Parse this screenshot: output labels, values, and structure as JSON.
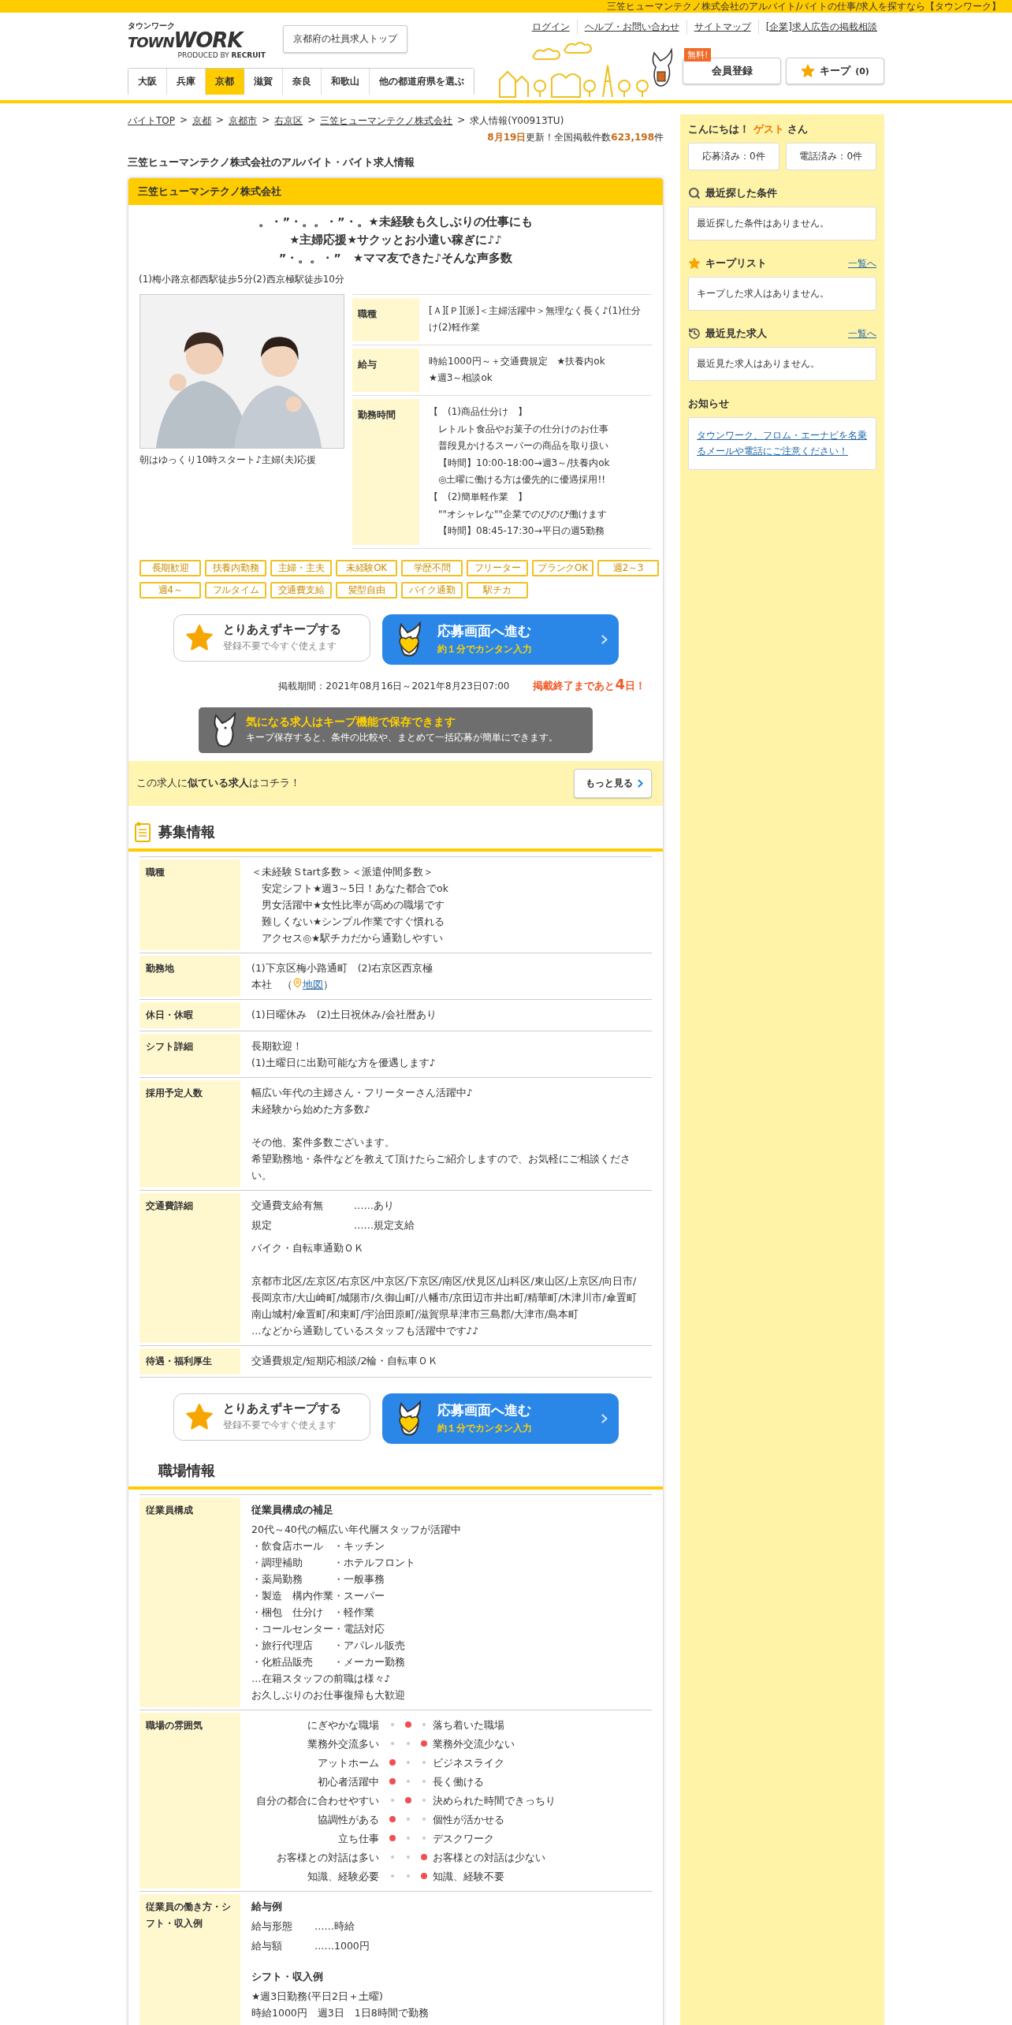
{
  "top_bar": {
    "text": "三笠ヒューマンテクノ株式会社のアルバイト/バイトの仕事/求人を探すなら【タウンワーク】"
  },
  "header": {
    "logo_kana": "タウンワーク",
    "logo_town": "TOWN",
    "logo_work": "WORK",
    "logo_sub": "PRODUCED BY",
    "logo_brand": "RECRUIT",
    "top_button": "京都府の社員求人トップ",
    "links": [
      "ログイン",
      "ヘルプ・お問い合わせ",
      "サイトマップ",
      "[企業]求人広告の掲載相談"
    ],
    "prefecture_tabs": [
      {
        "label": "大阪",
        "selected": false
      },
      {
        "label": "兵庫",
        "selected": false
      },
      {
        "label": "京都",
        "selected": true
      },
      {
        "label": "滋賀",
        "selected": false
      },
      {
        "label": "奈良",
        "selected": false
      },
      {
        "label": "和歌山",
        "selected": false
      },
      {
        "label": "他の都道府県を選ぶ",
        "selected": false
      }
    ],
    "free_badge": "無料!",
    "register_button": "会員登録",
    "keep_button": {
      "label": "キープ",
      "count": "(0)"
    }
  },
  "breadcrumb_separator": ">",
  "breadcrumb": [
    "バイトTOP",
    "京都",
    "京都市",
    "右京区",
    "三笠ヒューマンテクノ株式会社",
    "求人情報(Y00913TU)"
  ],
  "update": "**8月19日**更新！全国掲載件数**623,198**件",
  "page_title": "三笠ヒューマンテクノ株式会社のアルバイト・バイト求人情報",
  "job": {
    "company": "三笠ヒューマンテクノ株式会社",
    "catch": [
      "。・”・。。・”・。★未経験も久しぶりの仕事にも",
      "★主婦応援★サクッとお小遣い稼ぎに♪♪",
      "”・。。・”　★ママ友できた♪そんな声多数"
    ],
    "access": "(1)梅小路京都西駅徒歩5分(2)西京極駅徒歩10分",
    "photo_caption": "朝はゆっくり10時スタート♪主婦(夫)応援",
    "summary": [
      {
        "label": "職種",
        "lines": [
          "[Ａ][Ｐ][派]＜主婦活躍中＞無理なく長く♪(1)仕分け(2)軽作業"
        ]
      },
      {
        "label": "給与",
        "lines": [
          "時給1000円～＋交通費規定　★扶養内ok",
          "★週3～相談ok"
        ]
      },
      {
        "label": "勤務時間",
        "lines": [
          "【　(1)商品仕分け　】",
          "　レトルト食品やお菓子の仕分けのお仕事",
          "　普段見かけるスーパーの商品を取り扱い",
          "　【時間】10:00-18:00→週3～/扶養内ok",
          "　◎土曜に働ける方は優先的に優遇採用!!",
          "【　(2)簡単軽作業　】",
          "　\"\"オシャレな\"\"企業でのびのび働けます",
          "　【時間】08:45-17:30→平日の週5勤務"
        ]
      }
    ],
    "tags": [
      "長期歓迎",
      "扶養内勤務",
      "主婦・主夫",
      "未経験OK",
      "学歴不問",
      "フリーター",
      "ブランクOK",
      "週2～3",
      "週4～",
      "フルタイム",
      "交通費支給",
      "髪型自由",
      "バイク通勤",
      "駅チカ"
    ],
    "keep_button": {
      "title": "とりあえずキープする",
      "sub": "登録不要で今すぐ使えます"
    },
    "apply_button": {
      "title": "応募画面へ進む",
      "sub": "約１分でカンタン入力"
    },
    "period": "掲載期間：2021年08月16日～2021年8月23日07:00",
    "deadline": "掲載終了まであと**4**日！",
    "keep_banner": {
      "title": "気になる求人はキープ機能で保存できます",
      "text": "キープ保存すると、条件の比較や、まとめて一括応募が簡単にできます。"
    },
    "similar": {
      "text": "この求人に**似ている求人**はコチラ！",
      "button": "もっと見る"
    }
  },
  "recruit": {
    "heading": "募集情報",
    "rows": [
      {
        "kind": "text",
        "label": "職種",
        "lines": [
          "＜未経験Ｓtart多数＞＜派遣仲間多数＞",
          "　安定シフト★週3～5日！あなた都合でok",
          "　男女活躍中★女性比率が高めの職場です",
          "　難しくない★シンプル作業ですぐ慣れる",
          "　アクセス◎★駅チカだから通勤しやすい"
        ]
      },
      {
        "kind": "location",
        "label": "勤務地",
        "lines": [
          "(1)下京区梅小路通町　(2)右京区西京極"
        ],
        "map": {
          "before": "本社　（",
          "link": "地図",
          "after": "）"
        }
      },
      {
        "kind": "text",
        "label": "休日・休暇",
        "lines": [
          "(1)日曜休み　(2)土日祝休み/会社暦あり"
        ]
      },
      {
        "kind": "text",
        "label": "シフト詳細",
        "lines": [
          "長期歓迎！",
          "(1)土曜日に出勤可能な方を優遇します♪"
        ]
      },
      {
        "kind": "paragraphs",
        "label": "採用予定人数",
        "paragraphs": [
          [
            "幅広い年代の主婦さん・フリーターさん活躍中♪",
            "未経験から始めた方多数♪"
          ],
          [
            "その他、案件多数ございます。",
            "希望勤務地・条件などを教えて頂けたらご紹介しますので、お気軽にご相談ください。"
          ]
        ]
      },
      {
        "kind": "transport",
        "label": "交通費詳細",
        "pairs": [
          {
            "term": "交通費支給有無",
            "value": "……あり"
          },
          {
            "term": "規定",
            "value": "……規定支給"
          }
        ],
        "paragraphs": [
          [
            "バイク・自転車通勤ＯＫ"
          ],
          [
            "京都市北区/左京区/右京区/中京区/下京区/南区/伏見区/山科区/東山区/上京区/向日市/長岡京市/大山崎町/城陽市/久御山町/八幡市/京田辺市井出町/精華町/木津川市/傘置町南山城村/傘置町/和束町/宇治田原町/滋賀県草津市三島郡/大津市/島本町",
            "…などから通勤しているスタッフも活躍中です♪♪"
          ]
        ]
      },
      {
        "kind": "text",
        "label": "待遇・福利厚生",
        "lines": [
          "交通費規定/短期応相談/2輪・自転車ＯＫ"
        ]
      }
    ],
    "keep_button": {
      "title": "とりあえずキープする",
      "sub": "登録不要で今すぐ使えます"
    },
    "apply_button": {
      "title": "応募画面へ進む",
      "sub": "約１分でカンタン入力"
    }
  },
  "workplace": {
    "heading": "職場情報",
    "rows": [
      {
        "kind": "composition",
        "label": "従業員構成",
        "title": "従業員構成の補足",
        "lines": [
          "20代～40代の幅広い年代層スタッフが活躍中",
          "・飲食店ホール　・キッチン",
          "・調理補助　　　・ホテルフロント",
          "・薬局勤務　　　・一般事務",
          "・製造　構内作業・スーパー",
          "・梱包　仕分け　・軽作業",
          "・コールセンター・電話対応",
          "・旅行代理店　　・アパレル販売",
          "・化粧品販売　　・メーカー勤務",
          "…在籍スタッフの前職は様々♪",
          "お久しぶりのお仕事復帰も大歓迎"
        ]
      },
      {
        "kind": "mood",
        "label": "職場の雰囲気",
        "items": [
          {
            "left": "にぎやかな職場",
            "right": "落ち着いた職場",
            "level": 0.5
          },
          {
            "left": "業務外交流多い",
            "right": "業務外交流少ない",
            "level": 1
          },
          {
            "left": "アットホーム",
            "right": "ビジネスライク",
            "level": 0
          },
          {
            "left": "初心者活躍中",
            "right": "長く働ける",
            "level": 0
          },
          {
            "left": "自分の都合に合わせやすい",
            "right": "決められた時間できっちり",
            "level": 0.5
          },
          {
            "left": "協調性がある",
            "right": "個性が活かせる",
            "level": 0
          },
          {
            "left": "立ち仕事",
            "right": "デスクワーク",
            "level": 0
          },
          {
            "left": "お客様との対話は多い",
            "right": "お客様との対話は少ない",
            "level": 1
          },
          {
            "left": "知識、経験必要",
            "right": "知識、経験不要",
            "level": 1
          }
        ]
      },
      {
        "kind": "examples",
        "label": "従業員の働き方・シフト・収入例",
        "sections": [
          {
            "title": "給与例",
            "pairs": [
              {
                "term": "給与形態",
                "value": "……時給"
              },
              {
                "term": "給与額",
                "value": "……1000円"
              }
            ]
          },
          {
            "title": "シフト・収入例",
            "lines": [
              "★週3日勤務(平日2日＋土曜)",
              "時給1000円　週3日　1日8時間で勤務"
            ]
          }
        ]
      }
    ]
  },
  "sidebar": {
    "greeting": "こんにちは！ **ゲスト** さん",
    "counters": [
      "応募済み：0件",
      "電話済み：0件"
    ],
    "sections": [
      {
        "kind": "search",
        "title": "最近探した条件",
        "text": "最近探した条件はありません。"
      },
      {
        "kind": "star",
        "title": "キープリスト",
        "link": "一覧へ",
        "text": "キープした求人はありません。"
      },
      {
        "kind": "history",
        "title": "最近見た求人",
        "link": "一覧へ",
        "text": "最近見た求人はありません。"
      }
    ],
    "notice": {
      "title": "お知らせ",
      "link": "タウンワーク、フロム・エーナビを名乗るメールや電話にご注意ください！"
    }
  }
}
